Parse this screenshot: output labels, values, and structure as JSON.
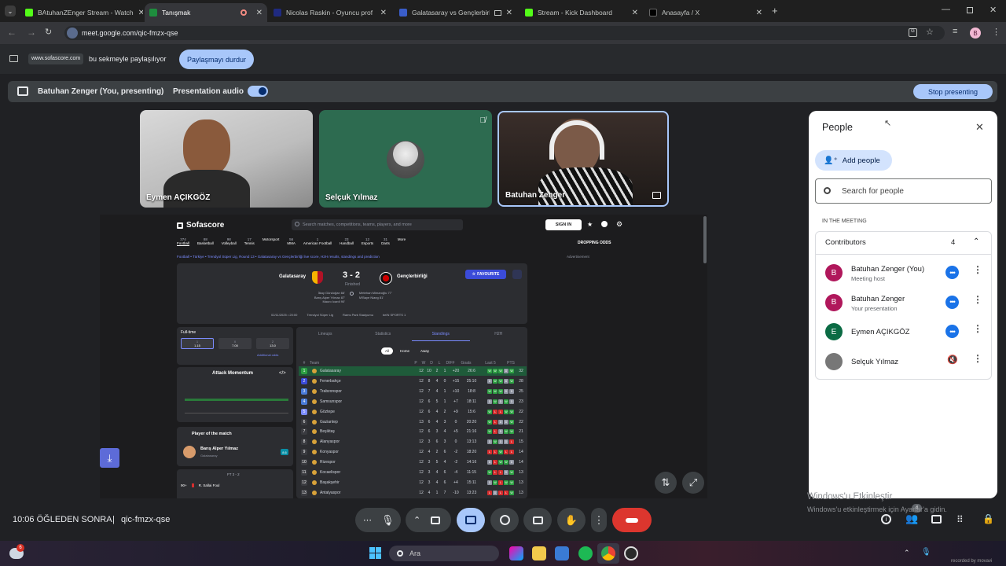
{
  "browser": {
    "tabs": [
      {
        "label": "BAtuhanZEnger Stream - Watch",
        "fav": "#53fc18"
      },
      {
        "label": "Tanışmak",
        "fav": "#1e8e3e"
      },
      {
        "label": "Nicolas Raskin - Oyuncu profili",
        "fav": "#1f2a80"
      },
      {
        "label": "Galatasaray vs Gençlerbirliği",
        "fav": "#3a5dc9"
      },
      {
        "label": "Stream - Kick Dashboard",
        "fav": "#53fc18"
      },
      {
        "label": "Anasayfa / X",
        "fav": "#000000"
      }
    ],
    "url": "meet.google.com/qic-fmzx-qse",
    "profile_initial": "B"
  },
  "share_bar": {
    "site": "www.sofascore.com",
    "text": "bu sekmeyle paylaşılıyor",
    "stop_button": "Paylaşmayı durdur"
  },
  "presenting_bar": {
    "presenter": "Batuhan Zenger (You, presenting)",
    "audio_label": "Presentation audio",
    "stop_button": "Stop presenting"
  },
  "participants": [
    {
      "name": "Eymen AÇIKGÖZ"
    },
    {
      "name": "Selçuk Yılmaz"
    },
    {
      "name": "Batuhan Zenger"
    }
  ],
  "sofascore": {
    "logo": "Sofascore",
    "search_placeholder": "Search matches, competitions, teams, players, and more",
    "sign_in": "SIGN IN",
    "sports": [
      {
        "count": "374",
        "label": "Football"
      },
      {
        "count": "88",
        "label": "Basketball"
      },
      {
        "count": "98",
        "label": "Volleyball"
      },
      {
        "count": "17",
        "label": "Tennis"
      },
      {
        "count": "",
        "label": "Motorsport"
      },
      {
        "count": "56",
        "label": "MMA"
      },
      {
        "count": "1",
        "label": "American Football"
      },
      {
        "count": "23",
        "label": "Handball"
      },
      {
        "count": "12",
        "label": "Esports"
      },
      {
        "count": "31",
        "label": "Darts"
      },
      {
        "count": "",
        "label": "More"
      }
    ],
    "dropping_odds": "DROPPING ODDS",
    "breadcrumb": "Football • Türkiye • Trendyol Süper Lig, Round 13 • Galatasaray vs Gençlerbirliği live score, H2H results, standings and prediction",
    "advertisement": "Advertisement",
    "match": {
      "home": "Galatasaray",
      "away": "Gençlerbirliği",
      "score": "3 - 2",
      "status": "Finished",
      "home_scorers": "İlkay Gündoğan 66'\nBarış Alper Yılmaz 87'\nMauro Icardi 90'",
      "away_scorers": "Metehan Mimaroğlu 77'\nM'Baye Niang 81'",
      "date": "02/11/2025 • 20:00",
      "league": "Trendyol Süper Lig",
      "venue": "Rams Park Stadyumu",
      "tv": "beIN SPORTS 1",
      "favourite": "FAVOURITE"
    },
    "odds": {
      "title": "Full-time",
      "items": [
        {
          "label": "1",
          "value": "1.15"
        },
        {
          "label": "X",
          "value": "7.00"
        },
        {
          "label": "2",
          "value": "13.0"
        }
      ],
      "more": "Additional odds"
    },
    "attack_momentum": "Attack Momentum",
    "potm": {
      "title": "Player of the match",
      "player": "Barış Alper Yılmaz",
      "team": "Galatasaray",
      "rating": "8.6"
    },
    "ft_label": "FT 3 - 2",
    "events": [
      {
        "minute": "90+",
        "text": "R. Sallai Foul"
      }
    ],
    "tabs": [
      "Lineups",
      "Statistics",
      "Standings",
      "H2H"
    ],
    "filters": [
      "All",
      "Home",
      "Away"
    ],
    "table_headers": [
      "#",
      "Team",
      "P",
      "W",
      "D",
      "L",
      "DIFF",
      "Goals",
      "Last 5",
      "PTS"
    ],
    "standings": [
      {
        "pos": "1",
        "team": "Galatasaray",
        "p": "12",
        "w": "10",
        "d": "2",
        "l": "1",
        "diff": "+20",
        "goals": "26:6",
        "form": "WWWDW",
        "pts": "32"
      },
      {
        "pos": "2",
        "team": "Fenerbahçe",
        "p": "12",
        "w": "8",
        "d": "4",
        "l": "0",
        "diff": "+15",
        "goals": "25:10",
        "form": "DWWDW",
        "pts": "28"
      },
      {
        "pos": "3",
        "team": "Trabzonspor",
        "p": "12",
        "w": "7",
        "d": "4",
        "l": "1",
        "diff": "+10",
        "goals": "18:8",
        "form": "WWWDD",
        "pts": "25"
      },
      {
        "pos": "4",
        "team": "Samsunspor",
        "p": "12",
        "w": "6",
        "d": "5",
        "l": "1",
        "diff": "+7",
        "goals": "18:11",
        "form": "DWDWD",
        "pts": "23"
      },
      {
        "pos": "5",
        "team": "Göztepe",
        "p": "12",
        "w": "6",
        "d": "4",
        "l": "2",
        "diff": "+9",
        "goals": "15:6",
        "form": "WLLWW",
        "pts": "22"
      },
      {
        "pos": "6",
        "team": "Gaziantep",
        "p": "13",
        "w": "6",
        "d": "4",
        "l": "3",
        "diff": "0",
        "goals": "20:20",
        "form": "WLDDW",
        "pts": "22"
      },
      {
        "pos": "7",
        "team": "Beşiktaş",
        "p": "12",
        "w": "6",
        "d": "3",
        "l": "4",
        "diff": "+5",
        "goals": "21:16",
        "form": "WLDWW",
        "pts": "21"
      },
      {
        "pos": "8",
        "team": "Alanyaspor",
        "p": "12",
        "w": "3",
        "d": "6",
        "l": "3",
        "diff": "0",
        "goals": "13:13",
        "form": "DWDDL",
        "pts": "15"
      },
      {
        "pos": "9",
        "team": "Konyaspor",
        "p": "12",
        "w": "4",
        "d": "2",
        "l": "6",
        "diff": "-2",
        "goals": "18:20",
        "form": "LLWLL",
        "pts": "14"
      },
      {
        "pos": "10",
        "team": "Rizespor",
        "p": "12",
        "w": "3",
        "d": "5",
        "l": "4",
        "diff": "-2",
        "goals": "14:16",
        "form": "DLWWD",
        "pts": "14"
      },
      {
        "pos": "11",
        "team": "Kocaelispor",
        "p": "12",
        "w": "3",
        "d": "4",
        "l": "6",
        "diff": "-4",
        "goals": "11:15",
        "form": "WLLDW",
        "pts": "13"
      },
      {
        "pos": "12",
        "team": "Başakşehir",
        "p": "12",
        "w": "3",
        "d": "4",
        "l": "6",
        "diff": "+4",
        "goals": "15:11",
        "form": "DWLWW",
        "pts": "13"
      },
      {
        "pos": "13",
        "team": "Antalyaspor",
        "p": "12",
        "w": "4",
        "d": "1",
        "l": "7",
        "diff": "-10",
        "goals": "13:23",
        "form": "LDLLW",
        "pts": "13"
      }
    ]
  },
  "people_panel": {
    "title": "People",
    "add_people": "Add people",
    "search_placeholder": "Search for people",
    "section_label": "IN THE MEETING",
    "group": "Contributors",
    "count": "4",
    "people": [
      {
        "initial": "B",
        "name": "Batuhan Zenger (You)",
        "sub": "Meeting host",
        "color": "#b0175b"
      },
      {
        "initial": "B",
        "name": "Batuhan Zenger",
        "sub": "Your presentation",
        "color": "#b0175b"
      },
      {
        "initial": "E",
        "name": "Eymen AÇIKGÖZ",
        "sub": "",
        "color": "#0b6b44"
      },
      {
        "initial": "",
        "name": "Selçuk Yılmaz",
        "sub": "",
        "color": "#777777"
      }
    ]
  },
  "bottom": {
    "time": "10:06 ÖĞLEDEN SONRA",
    "separator": "|",
    "code": "qic-fmzx-qse",
    "people_badge": "4"
  },
  "watermark": {
    "line1": "Windows'u Etkinleştir",
    "line2": "Windows'u etkinleştirmek için Ayarlar'a gidin."
  },
  "taskbar": {
    "search": "Ara",
    "weather_badge": "6"
  },
  "recorder": "recorded by movavi"
}
